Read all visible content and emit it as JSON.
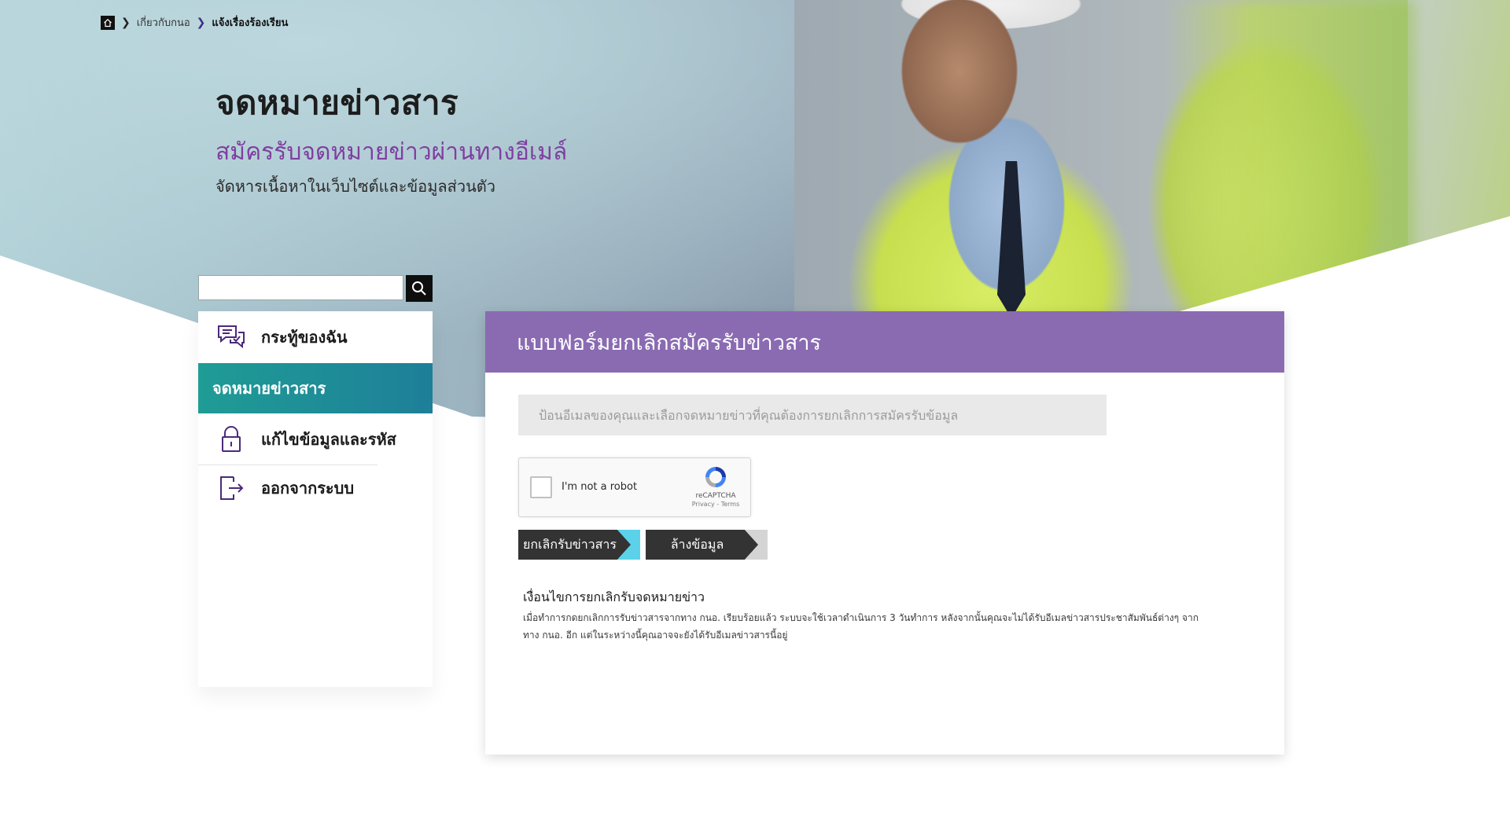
{
  "breadcrumb": {
    "items": [
      "เกี่ยวกับกนอ",
      "แจ้งเรื่องร้องเรียน"
    ]
  },
  "header": {
    "title": "จดหมายข่าวสาร",
    "subtitle": "สมัครรับจดหมายข่าวผ่านทางอีเมล์",
    "description": "จัดหารเนื้อหาในเว็บไซต์และข้อมูลส่วนตัว"
  },
  "search": {
    "placeholder": "",
    "value": ""
  },
  "sidebar": {
    "items": [
      {
        "label": "กระทู้ของฉัน",
        "icon": "chat-bubbles-icon"
      },
      {
        "label": "จดหมายข่าวสาร",
        "active": true
      },
      {
        "label": "แก้ไขข้อมูลและรหัส",
        "icon": "lock-icon"
      },
      {
        "label": "ออกจากระบบ",
        "icon": "logout-icon"
      }
    ]
  },
  "form": {
    "title": "แบบฟอร์มยกเลิกสมัครรับข่าวสาร",
    "email_placeholder": "ป้อนอีเมลของคุณและเลือกจดหมายข่าวที่คุณต้องการยกเลิกการสมัครรับข้อมูล",
    "recaptcha": {
      "label": "I'm not a robot",
      "brand": "reCAPTCHA",
      "links": "Privacy - Terms"
    },
    "buttons": {
      "unsubscribe": "ยกเลิกรับข่าวสาร",
      "clear": "ล้างข้อมูล"
    },
    "terms": {
      "title": "เงื่อนไขการยกเลิกรับจดหมายข่าว",
      "body": "เมื่อทำการกดยกเลิกการรับข่าวสารจากทาง กนอ. เรียบร้อยแล้ว ระบบจะใช้เวลาดำเนินการ 3 วันทำการ หลังจากนั้นคุณจะไม่ได้รับอีเมลข่าวสารประชาสัมพันธ์ต่างๆ จากทาง กนอ. อีก แต่ในระหว่างนี้คุณอาจจะยังได้รับอีเมลข่าวสารนี้อยู่"
    }
  },
  "colors": {
    "accent_purple": "#8a6bb2",
    "subtitle_purple": "#7f3fa0",
    "active_teal": "#1f9c96",
    "button_dark": "#333333",
    "button_cyan_tail": "#5bd2ea",
    "button_gray_tail": "#d4d4d4"
  }
}
